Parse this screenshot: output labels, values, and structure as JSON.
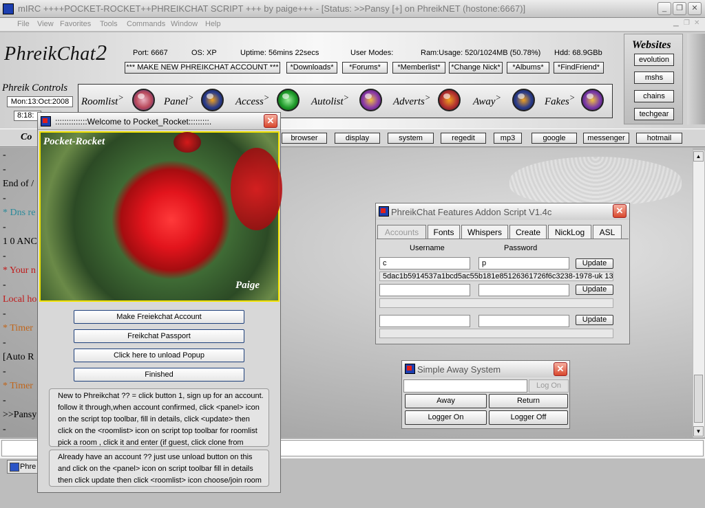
{
  "window": {
    "title": "mIRC ++++POCKET-ROCKET++PHREIKCHAT SCRIPT +++ by paige+++ - [Status: >>Pansy [+] on PhreikNET (hostone:6667)]",
    "minimize": "_",
    "restore": "❐",
    "close": "✕"
  },
  "menu": [
    "File",
    "View",
    "Favorites",
    "Tools",
    "Commands",
    "Window",
    "Help"
  ],
  "logo": {
    "text": "PhreikChat",
    "number": "2"
  },
  "stats": {
    "port": "Port: 6667",
    "os": "OS: XP",
    "uptime": "Uptime: 56mins 22secs",
    "usermodes": "User Modes:",
    "ram": "Ram:Usage: 520/1024MB (50.78%)",
    "hdd": "Hdd:  68.9GBb"
  },
  "top_buttons": [
    "*** MAKE NEW PHREIKCHAT ACCOUNT ***",
    "*Downloads*",
    "*Forums*",
    "*Memberlist*",
    "*Change Nick*",
    "*Albums*",
    "*FindFriend*"
  ],
  "controls": {
    "label": "Phreik Controls",
    "date": "Mon:13:Oct:2008",
    "time": "8:18:",
    "items": [
      {
        "label": "Roomlist",
        "arrow": ">",
        "icon": "roomlist-orb-icon",
        "color": "#b8485a"
      },
      {
        "label": "Panel",
        "arrow": ">",
        "icon": "panel-orb-icon",
        "color": "#2c3d8a"
      },
      {
        "label": "Access",
        "arrow": ">",
        "icon": "access-dollar-icon",
        "color": "#1f9a2a"
      },
      {
        "label": "Autolist",
        "arrow": ">",
        "icon": "autolist-orb-icon",
        "color": "#8a3aa8"
      },
      {
        "label": "Adverts",
        "arrow": ">",
        "icon": "adverts-orb-icon",
        "color": "#b03030"
      },
      {
        "label": "Away",
        "arrow": ">",
        "icon": "away-orb-icon",
        "color": "#2c3d8a"
      },
      {
        "label": "Fakes",
        "arrow": ">",
        "icon": "fakes-orb-icon",
        "color": "#7a3aa8"
      }
    ]
  },
  "websites": {
    "title": "Websites",
    "links": [
      "evolution",
      "mshs",
      "chains",
      "techgear"
    ]
  },
  "quickbar": {
    "partial_label": "Co",
    "buttons": [
      "browser",
      "display",
      "system",
      "regedit",
      "mp3",
      "google",
      "messenger",
      "hotmail"
    ]
  },
  "chat_lines": [
    {
      "text": "-",
      "color": "#000000"
    },
    {
      "text": "-",
      "color": "#000000"
    },
    {
      "text": "End of /",
      "color": "#000000"
    },
    {
      "text": "-",
      "color": "#000000"
    },
    {
      "text": "* Dns re",
      "color": "#2a8a9a"
    },
    {
      "text": "-",
      "color": "#000000"
    },
    {
      "text": "1 0 ANC",
      "color": "#000000"
    },
    {
      "text": "-",
      "color": "#000000"
    },
    {
      "text": "* Your n",
      "color": "#c01818"
    },
    {
      "text": "-",
      "color": "#000000"
    },
    {
      "text": "Local ho",
      "color": "#c01818"
    },
    {
      "text": "-",
      "color": "#000000"
    },
    {
      "text": "* Timer",
      "color": "#c0651a"
    },
    {
      "text": "-",
      "color": "#000000"
    },
    {
      "text": "[Auto R",
      "color": "#000000"
    },
    {
      "text": "-",
      "color": "#000000"
    },
    {
      "text": "* Timer",
      "color": "#c0651a"
    },
    {
      "text": "-",
      "color": "#000000"
    },
    {
      "text": ">>Pansy",
      "color": "#000000"
    },
    {
      "text": "-",
      "color": "#000000"
    }
  ],
  "taskbar": {
    "item": "Phre"
  },
  "welcome": {
    "title": "::::::::::::::Welcome to Pocket_Rocket:::::::::.",
    "photo_top": "Pocket-Rocket",
    "photo_bottom": "Paige",
    "buttons": [
      "Make Freiekchat Account",
      "Freikchat Passport",
      "Click here to unload Popup",
      "Finished"
    ],
    "info1": [
      "New to Phreikchat ?? = click button 1, sign up for an account.",
      "follow it through,when account confirmed, click <panel> icon",
      "on the script top toolbar, fill in details, click <update> then",
      "click on the <roomlist> icon on script top toolbar for roomlist",
      "pick a room , click it and enter (if guest, click clone from menu)"
    ],
    "info2": [
      "Already have an account ?? just use unload button on this",
      "and click on the <panel> icon on script toolbar fill in details",
      "then click update then click <roomlist> icon choose/join room"
    ]
  },
  "features": {
    "title": "PhreikChat Features Addon Script V1.4c",
    "tabs": [
      "Accounts",
      "Fonts",
      "Whispers",
      "Create",
      "NickLog",
      "ASL"
    ],
    "username_label": "Username",
    "password_label": "Password",
    "rows": [
      {
        "username": "c",
        "password": "p",
        "hash": "5dac1b5914537a1bcd5ac55b181e85126361726f6c3238-1978-uk 13"
      },
      {
        "username": "",
        "password": "",
        "hash": ""
      },
      {
        "username": "",
        "password": "",
        "hash": ""
      }
    ],
    "update_label": "Update"
  },
  "away": {
    "title": "Simple Away System",
    "input": "",
    "logon": "Log On",
    "buttons": [
      "Away",
      "Return",
      "Logger On",
      "Logger Off"
    ]
  }
}
